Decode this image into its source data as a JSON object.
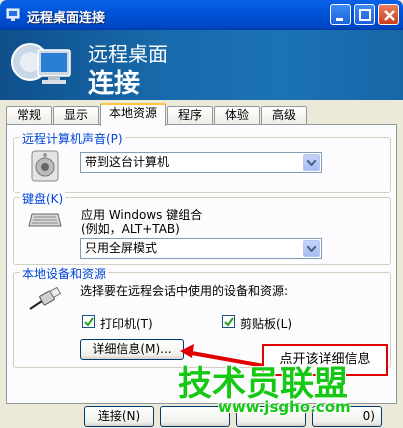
{
  "window": {
    "title": "远程桌面连接",
    "banner_line1": "远程桌面",
    "banner_line2": "连接"
  },
  "tabs": [
    {
      "label": "常规"
    },
    {
      "label": "显示"
    },
    {
      "label": "本地资源",
      "active": true
    },
    {
      "label": "程序"
    },
    {
      "label": "体验"
    },
    {
      "label": "高级"
    }
  ],
  "sound": {
    "label": "远程计算机声音(P)",
    "selected": "带到这台计算机"
  },
  "keyboard": {
    "label": "键盘(K)",
    "desc_line1": "应用 Windows 键组合",
    "desc_line2": "(例如，ALT+TAB)",
    "selected": "只用全屏模式"
  },
  "devices": {
    "label": "本地设备和资源",
    "desc": "选择要在远程会话中使用的设备和资源:",
    "printer": {
      "label": "打印机(T)",
      "checked": true
    },
    "clipboard": {
      "label": "剪贴板(L)",
      "checked": true
    },
    "details_button": "详细信息(M)..."
  },
  "footer": {
    "connect_button": "连接(N)",
    "partial_button": "0)"
  },
  "annotation": {
    "callout": "点开该详细信息"
  },
  "watermark": {
    "text": "技术员联盟",
    "url": "www.jsgho.com"
  },
  "colors": {
    "titlebar": "#0052d6",
    "banner": "#176aab",
    "group_label": "#0046d5",
    "callout_border": "#e00000",
    "watermark": "#14c814"
  }
}
